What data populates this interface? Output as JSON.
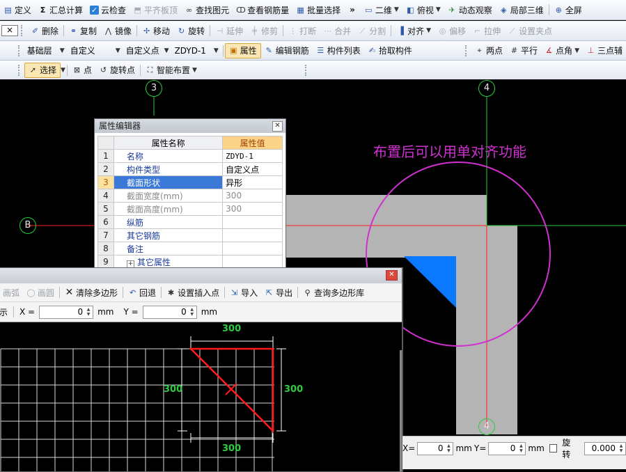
{
  "toolbar1": {
    "items": [
      {
        "icon": "define-icon",
        "label": "定义"
      },
      {
        "icon": "sigma-icon",
        "label": "汇总计算"
      },
      {
        "icon": "cloud-check-icon",
        "label": "云检查"
      },
      {
        "icon": "level-board-icon",
        "label": "平齐板顶"
      },
      {
        "icon": "binoculars-icon",
        "label": "查找图元"
      },
      {
        "icon": "glasses-icon",
        "label": "查看钢筋量"
      },
      {
        "icon": "batch-select-icon",
        "label": "批量选择"
      }
    ],
    "overflow": "»",
    "right": [
      {
        "icon": "2d-icon",
        "label": "二维"
      },
      {
        "icon": "cube-icon",
        "label": "俯视"
      },
      {
        "icon": "orbit-icon",
        "label": "动态观察"
      },
      {
        "icon": "partial-3d-icon",
        "label": "局部三维"
      },
      {
        "icon": "fullscreen-icon",
        "label": "全屏"
      }
    ]
  },
  "toolbar2": {
    "close": "×",
    "items": [
      {
        "icon": "delete-icon",
        "label": "删除"
      },
      {
        "icon": "copy-icon",
        "label": "复制"
      },
      {
        "icon": "mirror-icon",
        "label": "镜像"
      },
      {
        "icon": "move-icon",
        "label": "移动"
      },
      {
        "icon": "rotate-icon",
        "label": "旋转"
      },
      {
        "icon": "extend-icon",
        "label": "延伸"
      },
      {
        "icon": "trim-icon",
        "label": "修剪"
      },
      {
        "icon": "break-icon",
        "label": "打断"
      },
      {
        "icon": "merge-icon",
        "label": "合并"
      },
      {
        "icon": "split-icon",
        "label": "分割"
      },
      {
        "icon": "align-icon",
        "label": "对齐"
      },
      {
        "icon": "offset-icon",
        "label": "偏移"
      },
      {
        "icon": "stretch-icon",
        "label": "拉伸"
      },
      {
        "icon": "grip-point-icon",
        "label": "设置夹点"
      }
    ]
  },
  "toolbar3": {
    "floor": "基础层",
    "category": "自定义",
    "type": "自定义点",
    "component": "ZDYD-1",
    "items": [
      {
        "icon": "properties-icon",
        "label": "属性"
      },
      {
        "icon": "edit-rebar-icon",
        "label": "编辑钢筋"
      },
      {
        "icon": "component-list-icon",
        "label": "构件列表"
      },
      {
        "icon": "pick-component-icon",
        "label": "拾取构件"
      }
    ],
    "snap": [
      {
        "icon": "two-point-icon",
        "label": "两点"
      },
      {
        "icon": "parallel-icon",
        "label": "平行"
      },
      {
        "icon": "point-angle-icon",
        "label": "点角"
      },
      {
        "icon": "three-point-icon",
        "label": "三点辅"
      }
    ]
  },
  "toolbar4": {
    "items": [
      {
        "icon": "select-cursor-icon",
        "label": "选择"
      },
      {
        "icon": "point-icon",
        "label": "点"
      },
      {
        "icon": "rotate-point-icon",
        "label": "旋转点"
      },
      {
        "icon": "smart-layout-icon",
        "label": "智能布置"
      }
    ]
  },
  "canvas": {
    "axes": [
      "3",
      "4",
      "B",
      "4"
    ],
    "annotation": "布置后可以用单对齐功能",
    "colors": {
      "annotation": "#d030d0",
      "axis_green": "#2ecc40",
      "axis_red": "#ff2020",
      "wall": "#b4b4b4",
      "shape": "#0a78ff"
    }
  },
  "property_editor": {
    "title": "属性编辑器",
    "headers": [
      "属性名称",
      "属性值"
    ],
    "rows": [
      {
        "no": "1",
        "name": "名称",
        "value": "ZDYD-1"
      },
      {
        "no": "2",
        "name": "构件类型",
        "value": "自定义点"
      },
      {
        "no": "3",
        "name": "截面形状",
        "value": "异形",
        "selected": true
      },
      {
        "no": "4",
        "name": "截面宽度(mm)",
        "value": "300",
        "gray": true
      },
      {
        "no": "5",
        "name": "截面高度(mm)",
        "value": "300",
        "gray": true
      },
      {
        "no": "6",
        "name": "纵筋",
        "value": ""
      },
      {
        "no": "7",
        "name": "其它钢筋",
        "value": ""
      },
      {
        "no": "8",
        "name": "备注",
        "value": ""
      },
      {
        "no": "9",
        "name": "其它属性",
        "value": "",
        "expand": "+"
      }
    ]
  },
  "polygon_editor": {
    "tools": [
      {
        "icon": "arc-icon",
        "label": "画弧",
        "disabled": true
      },
      {
        "icon": "circle-icon",
        "label": "画圆",
        "disabled": true
      },
      {
        "icon": "clear-icon",
        "label": "清除多边形"
      },
      {
        "icon": "undo-icon",
        "label": "回退"
      },
      {
        "icon": "insert-point-icon",
        "label": "设置插入点"
      },
      {
        "icon": "import-icon",
        "label": "导入"
      },
      {
        "icon": "export-icon",
        "label": "导出"
      },
      {
        "icon": "search-icon",
        "label": "查询多边形库"
      }
    ],
    "coord_prefix": "示",
    "x_label": "X =",
    "x_value": "0",
    "x_unit": "mm",
    "y_label": "Y =",
    "y_value": "0",
    "y_unit": "mm",
    "dims": {
      "top": "300",
      "left": "300",
      "right": "300",
      "bottom": "300"
    }
  },
  "statusbar": {
    "x_label": "X=",
    "x_value": "0",
    "x_unit": "mm",
    "y_label": "Y=",
    "y_value": "0",
    "y_unit": "mm",
    "rotate_label": "旋转",
    "rotate_value": "0.000"
  }
}
